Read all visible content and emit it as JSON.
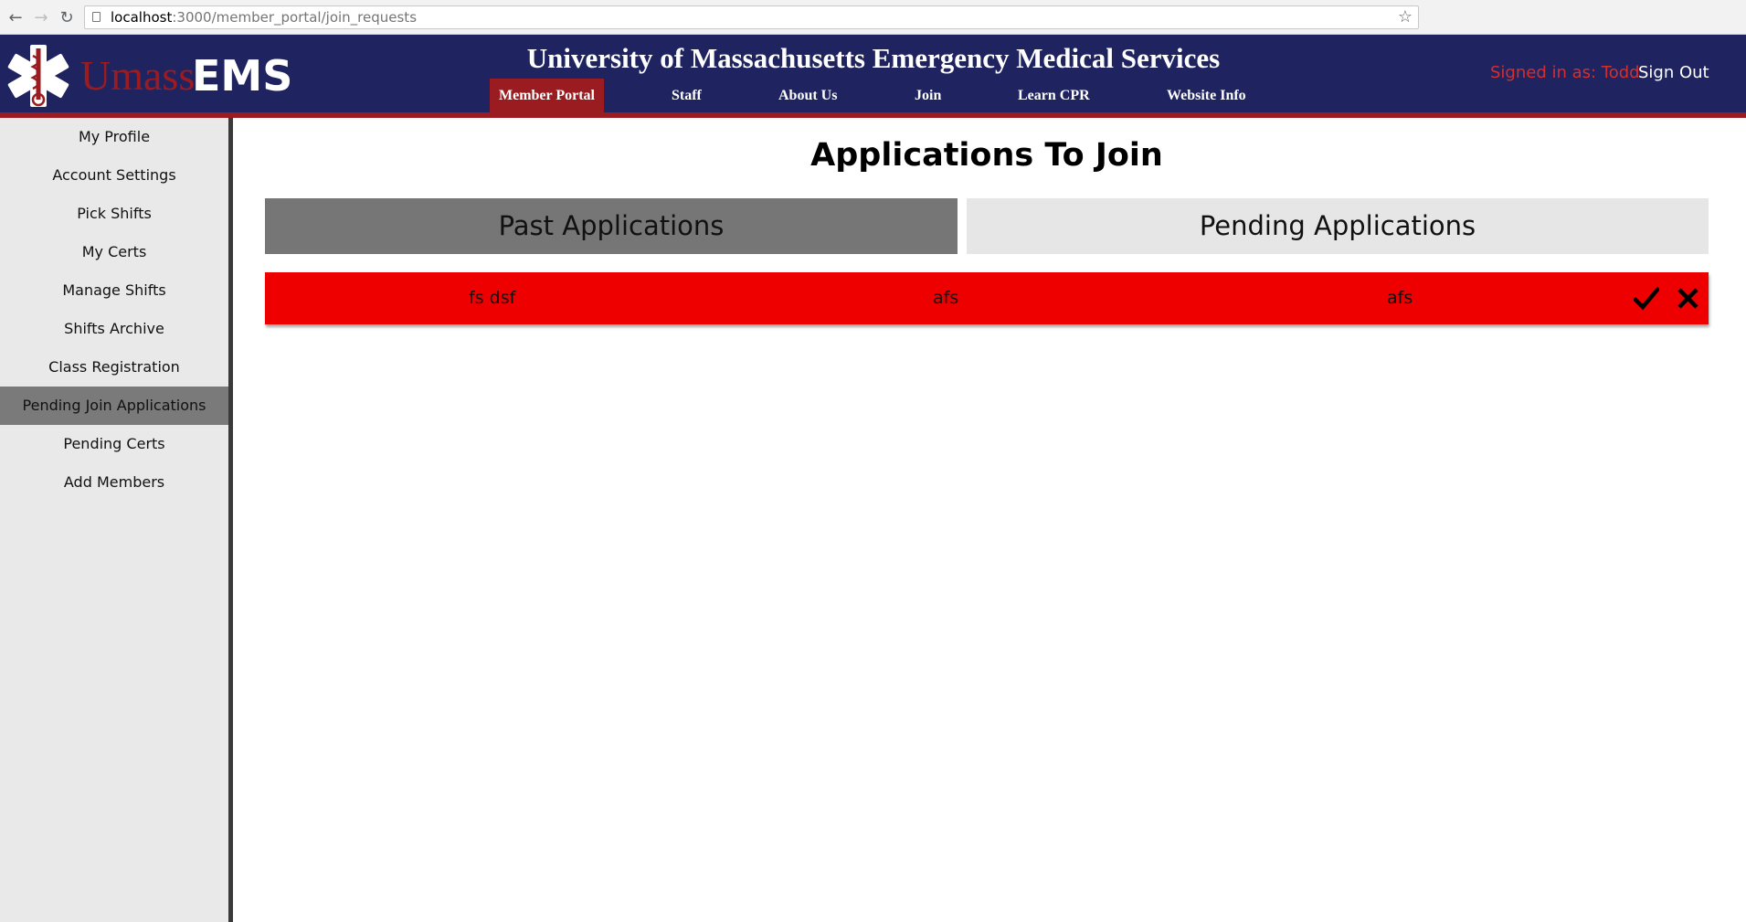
{
  "browser": {
    "url_host": "localhost",
    "url_path": ":3000/member_portal/join_requests"
  },
  "header": {
    "logo_umass": "Umass",
    "logo_ems": "EMS",
    "title": "University of Massachusetts Emergency Medical Services",
    "nav": [
      "Member Portal",
      "Staff",
      "About Us",
      "Join",
      "Learn CPR",
      "Website Info"
    ],
    "active_nav": "Member Portal",
    "signed_in": "Signed in as: Todd",
    "sign_out": "Sign Out",
    "colors": {
      "navy": "#1f2461",
      "crimson": "#9b1c20"
    }
  },
  "sidebar": {
    "items": [
      "My Profile",
      "Account Settings",
      "Pick Shifts",
      "My Certs",
      "Manage Shifts",
      "Shifts Archive",
      "Class Registration",
      "Pending Join Applications",
      "Pending Certs",
      "Add Members"
    ],
    "active_item": "Pending Join Applications"
  },
  "main": {
    "title": "Applications To Join",
    "tabs": {
      "past": "Past Applications",
      "pending": "Pending Applications"
    },
    "applications": [
      {
        "name": "fs dsf",
        "field2": "afs",
        "field3": "afs",
        "status_color": "#ee0000"
      }
    ],
    "icons": {
      "accept": "check-icon",
      "reject": "close-icon"
    }
  }
}
